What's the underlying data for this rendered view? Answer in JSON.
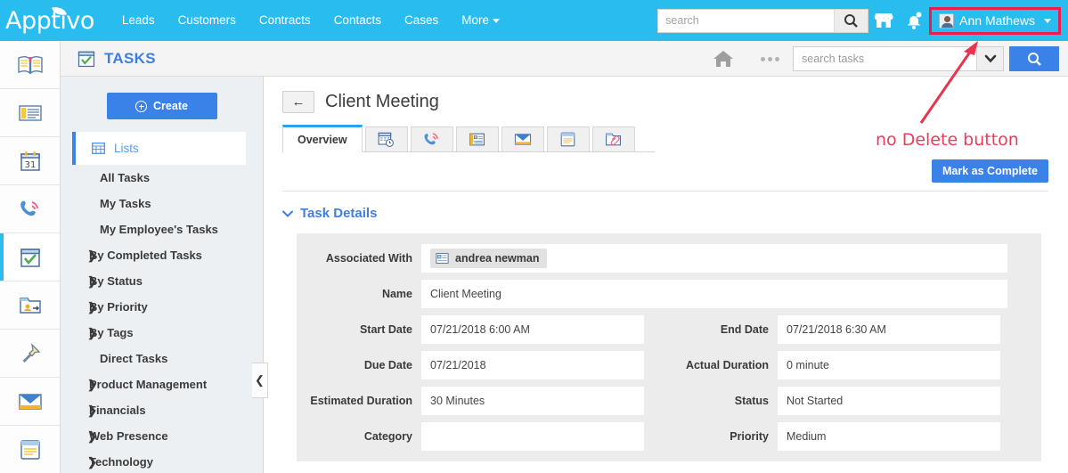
{
  "topnav": {
    "logo": "Apptivo",
    "links": [
      {
        "label": "Leads"
      },
      {
        "label": "Customers"
      },
      {
        "label": "Contracts"
      },
      {
        "label": "Contacts"
      },
      {
        "label": "Cases"
      },
      {
        "label": "More"
      }
    ],
    "search_placeholder": "search",
    "search_value": "",
    "search_icon": "search-icon",
    "store_icon": "store-icon",
    "notifications_icon": "bell-icon",
    "user_name": "Ann Mathews",
    "user_avatar_icon": "avatar-icon",
    "highlight_color": "#ee1c4c",
    "bar_color": "#29bdef"
  },
  "rail": {
    "items": [
      {
        "icon": "book-icon",
        "active": false
      },
      {
        "icon": "news-icon",
        "active": false
      },
      {
        "icon": "calendar-31-icon",
        "active": false
      },
      {
        "icon": "phone-call-icon",
        "active": false
      },
      {
        "icon": "tasks-check-icon",
        "active": true
      },
      {
        "icon": "contact-folder-icon",
        "active": false
      },
      {
        "icon": "pin-icon",
        "active": false
      },
      {
        "icon": "email-icon",
        "active": false
      },
      {
        "icon": "notes-icon",
        "active": false
      }
    ]
  },
  "appheader": {
    "app_icon": "tasks-check-icon",
    "title": "TASKS",
    "home_icon": "home-icon",
    "more_icon": "ellipsis-icon",
    "search_placeholder": "search tasks",
    "search_value": "",
    "dropdown_icon": "chevron-down-icon",
    "search_button_icon": "search-icon",
    "title_color": "#3f7fe0"
  },
  "sidebar": {
    "create_label": "Create",
    "create_icon": "plus-circle-icon",
    "lists": {
      "label": "Lists",
      "icon": "grid-icon"
    },
    "items": [
      {
        "label": "All Tasks",
        "expandable": false
      },
      {
        "label": "My Tasks",
        "expandable": false
      },
      {
        "label": "My Employee's Tasks",
        "expandable": false
      },
      {
        "label": "By Completed Tasks",
        "expandable": true
      },
      {
        "label": "By Status",
        "expandable": true
      },
      {
        "label": "By Priority",
        "expandable": true
      },
      {
        "label": "By Tags",
        "expandable": true
      },
      {
        "label": "Direct Tasks",
        "expandable": false
      },
      {
        "label": "Product Management",
        "expandable": true
      },
      {
        "label": "Financials",
        "expandable": true
      },
      {
        "label": "Web Presence",
        "expandable": true
      },
      {
        "label": "Technology",
        "expandable": true
      }
    ],
    "chevron_glyph": "❯",
    "collapse_glyph": "❮"
  },
  "main": {
    "back_icon": "back-arrow-icon",
    "back_glyph": "←",
    "record_title": "Client Meeting",
    "tabs": [
      {
        "label": "Overview",
        "icon": "",
        "active": true
      },
      {
        "label": "",
        "icon": "calendar-clock-icon",
        "active": false
      },
      {
        "label": "",
        "icon": "phone-call-icon",
        "active": false
      },
      {
        "label": "",
        "icon": "contact-card-icon",
        "active": false
      },
      {
        "label": "",
        "icon": "envelope-icon",
        "active": false
      },
      {
        "label": "",
        "icon": "notes-icon",
        "active": false
      },
      {
        "label": "",
        "icon": "attachment-folder-icon",
        "active": false
      }
    ],
    "mark_complete_label": "Mark as Complete",
    "section_title": "Task Details",
    "section_chevron": "⌄",
    "fields_left": [
      {
        "label": "Associated With",
        "value": "andrea newman",
        "type": "chip",
        "chip_icon": "contact-card-icon"
      },
      {
        "label": "Name",
        "value": "Client Meeting",
        "type": "text"
      },
      {
        "label": "Start Date",
        "value": "07/21/2018 6:00 AM",
        "type": "text"
      },
      {
        "label": "Due Date",
        "value": "07/21/2018",
        "type": "text"
      },
      {
        "label": "Estimated Duration",
        "value": "30 Minutes",
        "type": "text"
      },
      {
        "label": "Category",
        "value": "",
        "type": "text"
      }
    ],
    "fields_right": [
      {
        "label": "",
        "value": "",
        "type": "spacer"
      },
      {
        "label": "",
        "value": "",
        "type": "spacer"
      },
      {
        "label": "End Date",
        "value": "07/21/2018 6:30 AM",
        "type": "text"
      },
      {
        "label": "Actual Duration",
        "value": "0 minute",
        "type": "text"
      },
      {
        "label": "Status",
        "value": "Not Started",
        "type": "text"
      },
      {
        "label": "Priority",
        "value": "Medium",
        "type": "text"
      }
    ]
  },
  "annotations": {
    "note_text": "no Delete button",
    "note_color": "#ee3b5c",
    "arrow_color": "#e8344f"
  }
}
